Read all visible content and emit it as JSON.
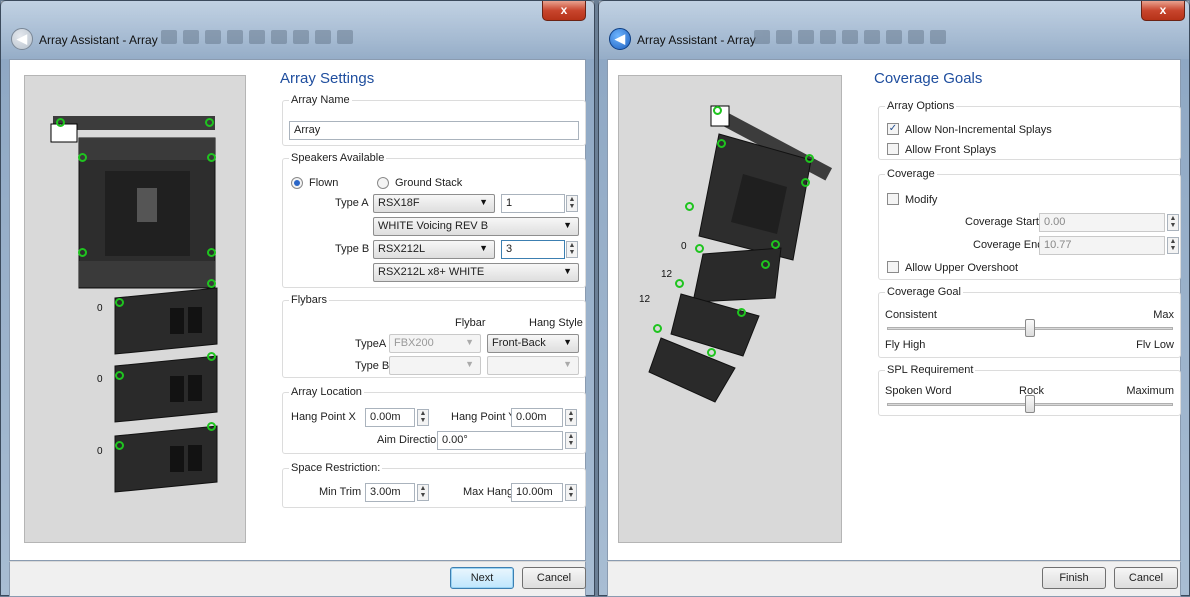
{
  "left_window": {
    "title": "Array Assistant - Array",
    "close_label": "x",
    "page_title": "Array Settings",
    "array_name": {
      "label": "Array Name",
      "value": "Array"
    },
    "speakers": {
      "label": "Speakers Available",
      "flown_label": "Flown",
      "ground_label": "Ground Stack",
      "type_a_label": "Type A",
      "type_a_model": "RSX18F",
      "type_a_qty": "1",
      "type_a_voicing": "WHITE Voicing REV B",
      "type_b_label": "Type B",
      "type_b_model": "RSX212L",
      "type_b_qty": "3",
      "type_b_voicing": "RSX212L x8+ WHITE"
    },
    "flybars": {
      "label": "Flybars",
      "col_flybar": "Flybar",
      "col_hang": "Hang Style",
      "type_a_label": "TypeA",
      "type_a_flybar": "FBX200",
      "type_a_hang": "Front-Back",
      "type_b_label": "Type B",
      "type_b_flybar": "",
      "type_b_hang": ""
    },
    "location": {
      "label": "Array Location",
      "hang_x_label": "Hang Point X",
      "hang_x": "0.00m",
      "hang_y_label": "Hang Point Y",
      "hang_y": "0.00m",
      "aim_label": "Aim Direction",
      "aim": "0.00°"
    },
    "restriction": {
      "label": "Space Restriction:",
      "min_trim_label": "Min Trim",
      "min_trim": "3.00m",
      "max_hang_label": "Max Hang",
      "max_hang": "10.00m"
    },
    "preview_labels": [
      "0",
      "0",
      "0"
    ],
    "next_label": "Next",
    "cancel_label": "Cancel"
  },
  "right_window": {
    "title": "Array Assistant - Array",
    "close_label": "x",
    "page_title": "Coverage Goals",
    "options": {
      "label": "Array Options",
      "non_incremental": "Allow Non-Incremental Splays",
      "non_incremental_checked": true,
      "front_splays": "Allow Front Splays",
      "front_splays_checked": false
    },
    "coverage": {
      "label": "Coverage",
      "modify": "Modify",
      "start_label": "Coverage Start",
      "start": "0.00",
      "end_label": "Coverage End",
      "end": "10.77",
      "upper_overshoot": "Allow Upper Overshoot"
    },
    "goal": {
      "label": "Coverage Goal",
      "left_top": "Consistent",
      "right_top": "Max",
      "left_bottom": "Fly High",
      "right_bottom": "Flv Low",
      "level": 0.5
    },
    "spl": {
      "label": "SPL Requirement",
      "left": "Spoken Word",
      "mid": "Rock",
      "right": "Maximum",
      "level": 0.5
    },
    "preview_labels": [
      "0",
      "12",
      "12"
    ],
    "finish_label": "Finish",
    "cancel_label": "Cancel"
  },
  "colors": {
    "accent": "#1f4e9e",
    "handle": "#1fc41f",
    "close": "#c8452d"
  }
}
